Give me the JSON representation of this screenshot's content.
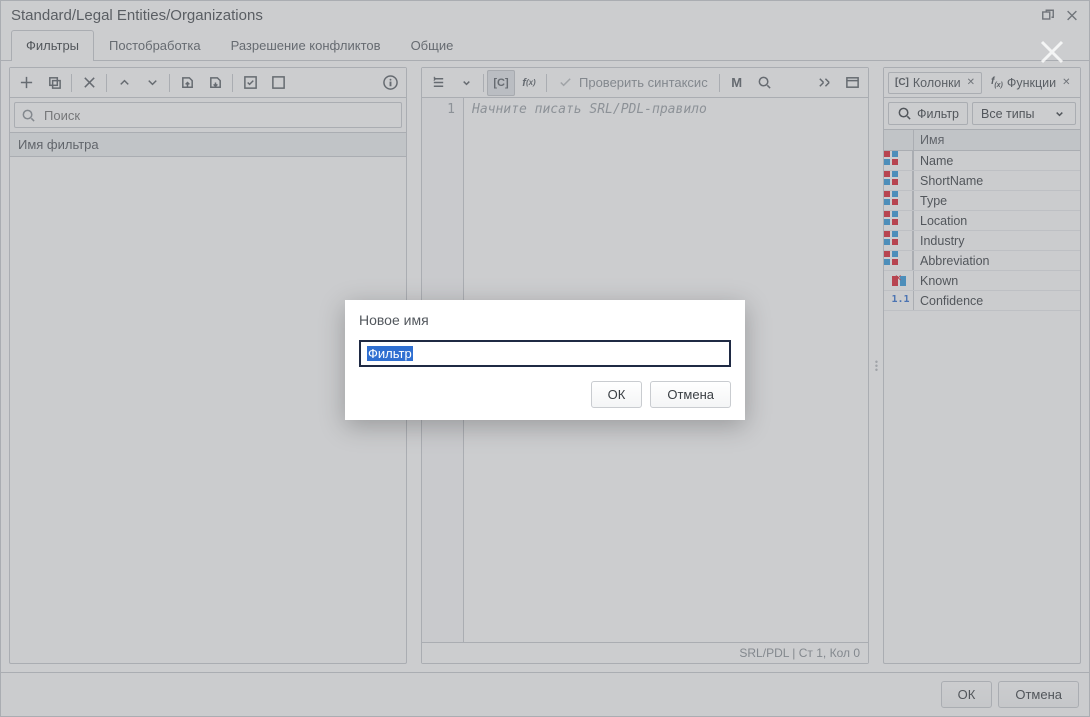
{
  "window": {
    "title": "Standard/Legal Entities/Organizations"
  },
  "tabs": [
    {
      "label": "Фильтры",
      "active": true
    },
    {
      "label": "Постобработка",
      "active": false
    },
    {
      "label": "Разрешение конфликтов",
      "active": false
    },
    {
      "label": "Общие",
      "active": false
    }
  ],
  "left": {
    "search_placeholder": "Поиск",
    "grid_header": "Имя фильтра"
  },
  "center": {
    "check_syntax_label": "Проверить синтаксис",
    "gutter": "1",
    "placeholder": "Начните писать SRL/PDL-правило",
    "status": "SRL/PDL | Ст 1, Кол 0"
  },
  "right": {
    "tabs": [
      {
        "label": "Колонки",
        "active": true
      },
      {
        "label": "Функции",
        "active": false
      }
    ],
    "filter_label": "Фильтр",
    "type_select": "Все типы",
    "header": "Имя",
    "rows": [
      {
        "icon": "c1",
        "name": "Name"
      },
      {
        "icon": "c1",
        "name": "ShortName"
      },
      {
        "icon": "c1",
        "name": "Type"
      },
      {
        "icon": "c1",
        "name": "Location"
      },
      {
        "icon": "c1",
        "name": "Industry"
      },
      {
        "icon": "c1",
        "name": "Abbreviation"
      },
      {
        "icon": "kn",
        "name": "Known"
      },
      {
        "icon": "num",
        "name": "Confidence"
      }
    ]
  },
  "footer": {
    "ok": "ОК",
    "cancel": "Отмена"
  },
  "dialog": {
    "title": "Новое имя",
    "value": "Фильтр",
    "ok": "ОК",
    "cancel": "Отмена"
  }
}
